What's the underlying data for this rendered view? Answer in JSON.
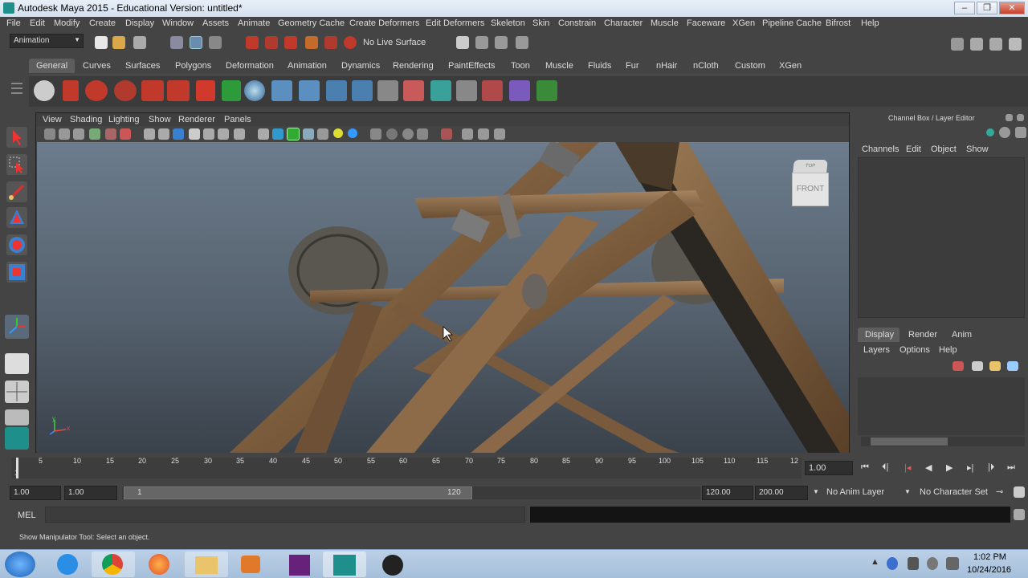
{
  "window": {
    "title": "Autodesk Maya 2015 - Educational Version: untitled*"
  },
  "menu": [
    "File",
    "Edit",
    "Modify",
    "Create",
    "Display",
    "Window",
    "Assets",
    "Animate",
    "Geometry Cache",
    "Create Deformers",
    "Edit Deformers",
    "Skeleton",
    "Skin",
    "Constrain",
    "Character",
    "Muscle",
    "Faceware",
    "XGen",
    "Pipeline Cache",
    "Bifrost",
    "Help"
  ],
  "status_line": {
    "menu_set": "Animation",
    "live_surface": "No Live Surface"
  },
  "shelf_tabs": [
    "General",
    "Curves",
    "Surfaces",
    "Polygons",
    "Deformation",
    "Animation",
    "Dynamics",
    "Rendering",
    "PaintEffects",
    "Toon",
    "Muscle",
    "Fluids",
    "Fur",
    "nHair",
    "nCloth",
    "Custom",
    "XGen"
  ],
  "panel_menu": [
    "View",
    "Shading",
    "Lighting",
    "Show",
    "Renderer",
    "Panels"
  ],
  "viewcube": {
    "top": "TOP",
    "front": "FRONT"
  },
  "axis": {
    "y": "y",
    "x": "x"
  },
  "channel_box": {
    "title": "Channel Box / Layer Editor",
    "menu": [
      "Channels",
      "Edit",
      "Object",
      "Show"
    ]
  },
  "layer_editor": {
    "tabs": [
      "Display",
      "Render",
      "Anim"
    ],
    "menu": [
      "Layers",
      "Options",
      "Help"
    ]
  },
  "timeline": {
    "ticks": [
      "5",
      "10",
      "15",
      "20",
      "25",
      "30",
      "35",
      "40",
      "45",
      "50",
      "55",
      "60",
      "65",
      "70",
      "75",
      "80",
      "85",
      "90",
      "95",
      "100",
      "105",
      "110",
      "115",
      "12"
    ],
    "start_marker": "1",
    "current_frame": "1.00"
  },
  "range": {
    "start": "1.00",
    "playback_start": "1.00",
    "slider_start": "1",
    "slider_end": "120",
    "playback_end": "120.00",
    "end": "200.00",
    "anim_layer": "No Anim Layer",
    "character_set": "No Character Set"
  },
  "command_line": {
    "label": "MEL"
  },
  "help_line": "Show Manipulator Tool: Select an object.",
  "clock": {
    "time": "1:02 PM",
    "date": "10/24/2016"
  },
  "colors": {
    "maya_bg": "#444444",
    "viewport_top": "#6c7c8c",
    "viewport_bottom": "#3a424b",
    "shelf_active": "#5d5d5d"
  }
}
